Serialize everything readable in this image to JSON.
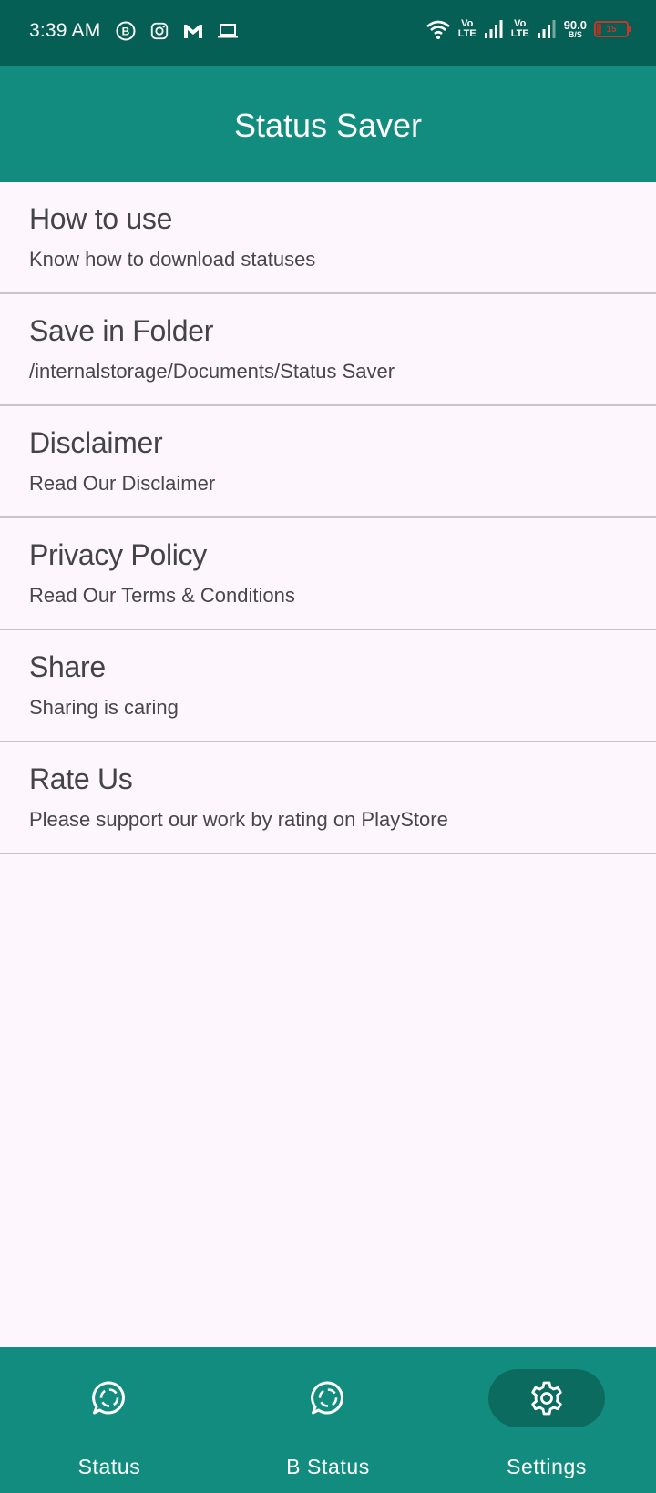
{
  "status_bar": {
    "time": "3:39 AM",
    "network_speed_value": "90.0",
    "network_speed_unit": "B/S",
    "volte_top": "Vo",
    "volte_bottom": "LTE",
    "battery_level": "15",
    "icons": [
      "business-chat-icon",
      "instagram-icon",
      "gmail-icon",
      "laptop-icon",
      "wifi-icon",
      "signal-icon",
      "battery-icon"
    ]
  },
  "app_bar": {
    "title": "Status Saver"
  },
  "settings": {
    "items": [
      {
        "title": "How to use",
        "subtitle": "Know how to download statuses"
      },
      {
        "title": "Save in Folder",
        "subtitle": "/internalstorage/Documents/Status Saver"
      },
      {
        "title": "Disclaimer",
        "subtitle": "Read Our Disclaimer"
      },
      {
        "title": "Privacy Policy",
        "subtitle": "Read Our Terms & Conditions"
      },
      {
        "title": "Share",
        "subtitle": "Sharing is caring"
      },
      {
        "title": "Rate Us",
        "subtitle": "Please support our work by rating on PlayStore"
      }
    ]
  },
  "bottom_nav": {
    "items": [
      {
        "label": "Status",
        "icon": "whatsapp-status-icon",
        "active": false
      },
      {
        "label": "B Status",
        "icon": "whatsapp-business-status-icon",
        "active": false
      },
      {
        "label": "Settings",
        "icon": "gear-icon",
        "active": true
      }
    ]
  },
  "colors": {
    "status_bar": "#065f54",
    "primary": "#128c7e",
    "active_pill": "#0c6b5f",
    "background": "#fdf7fd",
    "divider": "#c8c4c8"
  }
}
